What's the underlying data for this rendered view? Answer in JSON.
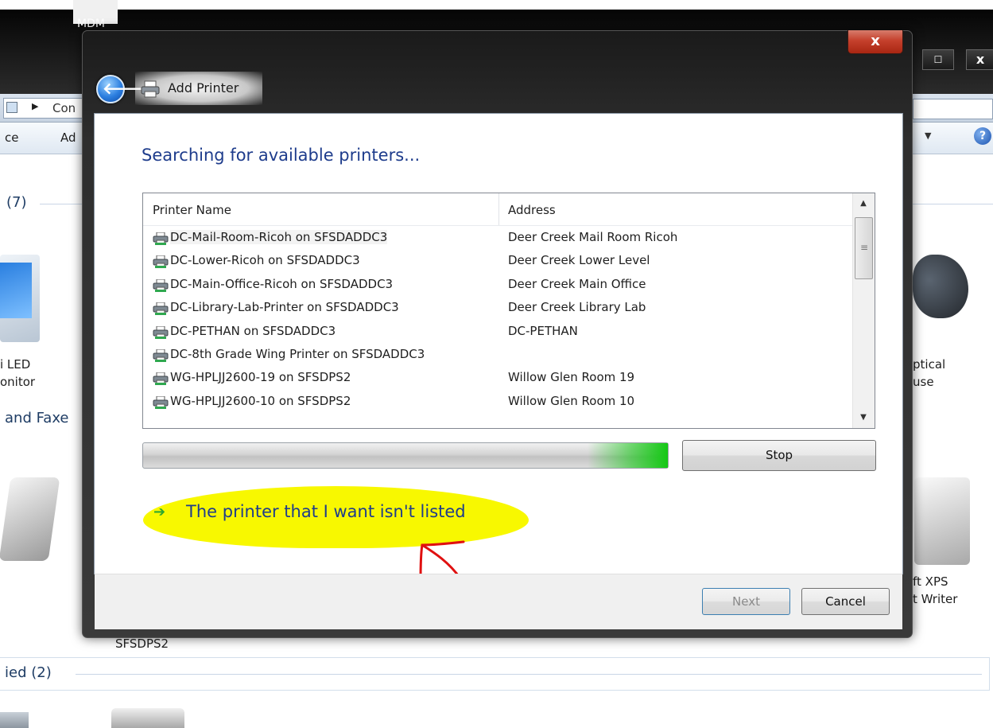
{
  "background": {
    "window_caption": "MDM",
    "address_crumb": "Con",
    "toolbar_items": [
      "ce",
      "Ad"
    ],
    "section_devices_count": "(7)",
    "device_left_label": "i LED\nonitor",
    "device_right_label": "ptical\nuse",
    "section_printers": "and Faxe",
    "xps_label": "ft XPS\nt Writer",
    "printer_sfsdps2": "SFSDPS2",
    "section_unspecified": "ied (2)"
  },
  "dialog": {
    "title": "Add Printer",
    "heading": "Searching for available printers...",
    "columns": {
      "name": "Printer Name",
      "address": "Address"
    },
    "printers": [
      {
        "name": "DC-Mail-Room-Ricoh on SFSDADDC3",
        "address": "Deer Creek Mail Room Ricoh"
      },
      {
        "name": "DC-Lower-Ricoh on SFSDADDC3",
        "address": "Deer Creek Lower Level"
      },
      {
        "name": "DC-Main-Office-Ricoh on SFSDADDC3",
        "address": "Deer Creek Main Office"
      },
      {
        "name": "DC-Library-Lab-Printer on SFSDADDC3",
        "address": "Deer Creek Library Lab"
      },
      {
        "name": "DC-PETHAN on SFSDADDC3",
        "address": "DC-PETHAN"
      },
      {
        "name": "DC-8th Grade Wing Printer on SFSDADDC3",
        "address": ""
      },
      {
        "name": "WG-HPLJJ2600-19 on SFSDPS2",
        "address": "Willow Glen Room 19"
      },
      {
        "name": "WG-HPLJJ2600-10 on SFSDPS2",
        "address": "Willow Glen Room 10"
      }
    ],
    "stop_label": "Stop",
    "not_listed_label": "The printer that I want isn't listed",
    "next_label": "Next",
    "cancel_label": "Cancel",
    "close_glyph": "x"
  },
  "colors": {
    "heading_blue": "#1e3c8c",
    "highlight_yellow": "#f8f800",
    "annotation_red": "#e01010",
    "progress_green": "#14c814"
  },
  "icons": {
    "back": "back-arrow-icon",
    "printer": "printer-icon",
    "link_arrow": "green-arrow-icon",
    "help": "help-icon"
  }
}
